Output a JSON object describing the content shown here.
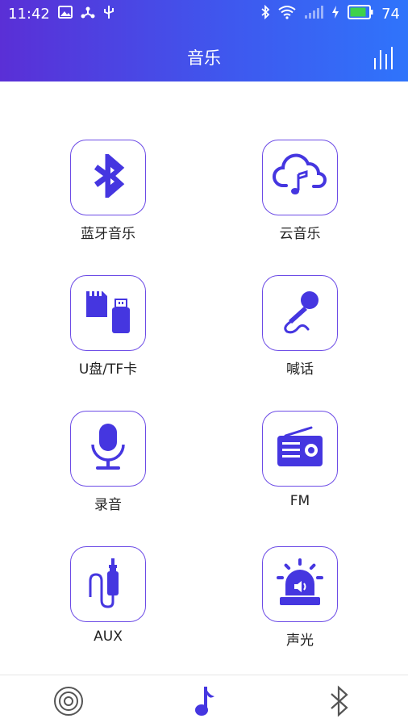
{
  "status_bar": {
    "time": "11:42",
    "battery": "74"
  },
  "header": {
    "title": "音乐"
  },
  "tiles": [
    {
      "label": "蓝牙音乐",
      "icon": "bluetooth-icon"
    },
    {
      "label": "云音乐",
      "icon": "cloud-music-icon"
    },
    {
      "label": "U盘/TF卡",
      "icon": "usb-sd-card-icon"
    },
    {
      "label": "喊话",
      "icon": "microphone-icon"
    },
    {
      "label": "录音",
      "icon": "recording-mic-icon"
    },
    {
      "label": "FM",
      "icon": "radio-icon"
    },
    {
      "label": "AUX",
      "icon": "aux-cable-icon"
    },
    {
      "label": "声光",
      "icon": "siren-light-icon"
    }
  ],
  "bottom_nav": [
    {
      "name": "speaker",
      "icon": "speaker-icon"
    },
    {
      "name": "music",
      "icon": "music-note-icon",
      "active": true
    },
    {
      "name": "bluetooth",
      "icon": "bluetooth-icon"
    }
  ],
  "colors": {
    "accent": "#4a35e0",
    "header_start": "#5a2fd6",
    "header_end": "#2f74fb"
  }
}
